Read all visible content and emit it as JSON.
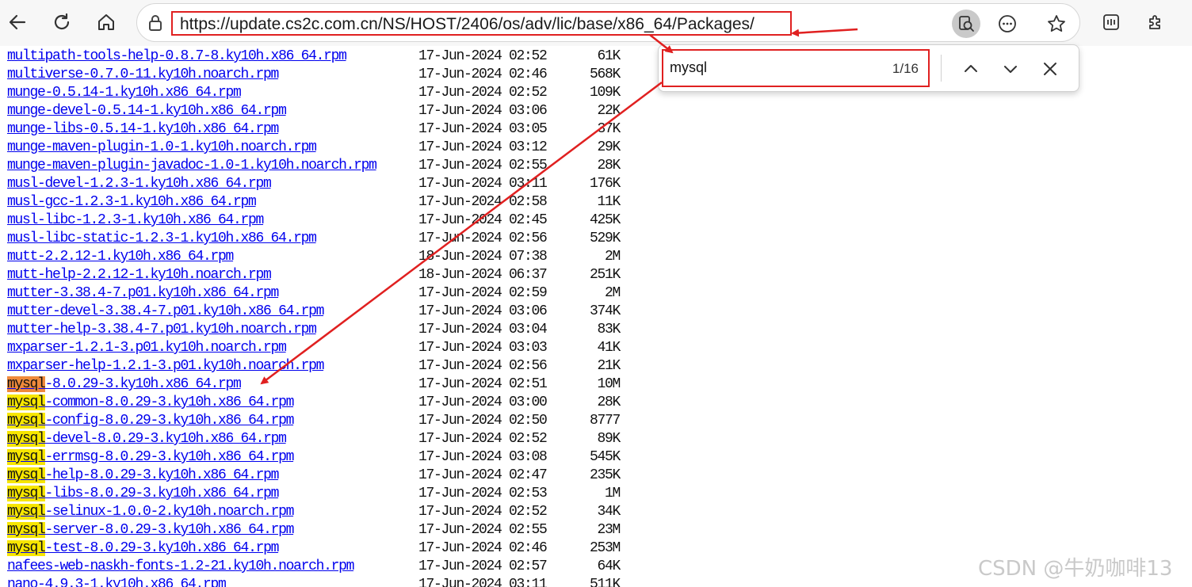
{
  "browser": {
    "url": "https://update.cs2c.com.cn/NS/HOST/2406/os/adv/lic/base/x86_64/Packages/"
  },
  "find": {
    "query": "mysql",
    "count": "1/16"
  },
  "listing": {
    "highlight_term": "mysql",
    "rows": [
      {
        "name": "multipath-tools-help-0.8.7-8.ky10h.x86_64.rpm",
        "date": "17-Jun-2024 02:52",
        "size": "61K"
      },
      {
        "name": "multiverse-0.7.0-11.ky10h.noarch.rpm",
        "date": "17-Jun-2024 02:46",
        "size": "568K"
      },
      {
        "name": "munge-0.5.14-1.ky10h.x86_64.rpm",
        "date": "17-Jun-2024 02:52",
        "size": "109K"
      },
      {
        "name": "munge-devel-0.5.14-1.ky10h.x86_64.rpm",
        "date": "17-Jun-2024 03:06",
        "size": "22K"
      },
      {
        "name": "munge-libs-0.5.14-1.ky10h.x86_64.rpm",
        "date": "17-Jun-2024 03:05",
        "size": "37K"
      },
      {
        "name": "munge-maven-plugin-1.0-1.ky10h.noarch.rpm",
        "date": "17-Jun-2024 03:12",
        "size": "29K"
      },
      {
        "name": "munge-maven-plugin-javadoc-1.0-1.ky10h.noarch.rpm",
        "date": "17-Jun-2024 02:55",
        "size": "28K"
      },
      {
        "name": "musl-devel-1.2.3-1.ky10h.x86_64.rpm",
        "date": "17-Jun-2024 03:11",
        "size": "176K"
      },
      {
        "name": "musl-gcc-1.2.3-1.ky10h.x86_64.rpm",
        "date": "17-Jun-2024 02:58",
        "size": "11K"
      },
      {
        "name": "musl-libc-1.2.3-1.ky10h.x86_64.rpm",
        "date": "17-Jun-2024 02:45",
        "size": "425K"
      },
      {
        "name": "musl-libc-static-1.2.3-1.ky10h.x86_64.rpm",
        "date": "17-Jun-2024 02:56",
        "size": "529K"
      },
      {
        "name": "mutt-2.2.12-1.ky10h.x86_64.rpm",
        "date": "18-Jun-2024 07:38",
        "size": "2M"
      },
      {
        "name": "mutt-help-2.2.12-1.ky10h.noarch.rpm",
        "date": "18-Jun-2024 06:37",
        "size": "251K"
      },
      {
        "name": "mutter-3.38.4-7.p01.ky10h.x86_64.rpm",
        "date": "17-Jun-2024 02:59",
        "size": "2M"
      },
      {
        "name": "mutter-devel-3.38.4-7.p01.ky10h.x86_64.rpm",
        "date": "17-Jun-2024 03:06",
        "size": "374K"
      },
      {
        "name": "mutter-help-3.38.4-7.p01.ky10h.noarch.rpm",
        "date": "17-Jun-2024 03:04",
        "size": "83K"
      },
      {
        "name": "mxparser-1.2.1-3.p01.ky10h.noarch.rpm",
        "date": "17-Jun-2024 03:03",
        "size": "41K"
      },
      {
        "name": "mxparser-help-1.2.1-3.p01.ky10h.noarch.rpm",
        "date": "17-Jun-2024 02:56",
        "size": "21K"
      },
      {
        "name": "mysql-8.0.29-3.ky10h.x86_64.rpm",
        "date": "17-Jun-2024 02:51",
        "size": "10M"
      },
      {
        "name": "mysql-common-8.0.29-3.ky10h.x86_64.rpm",
        "date": "17-Jun-2024 03:00",
        "size": "28K"
      },
      {
        "name": "mysql-config-8.0.29-3.ky10h.x86_64.rpm",
        "date": "17-Jun-2024 02:50",
        "size": "8777"
      },
      {
        "name": "mysql-devel-8.0.29-3.ky10h.x86_64.rpm",
        "date": "17-Jun-2024 02:52",
        "size": "89K"
      },
      {
        "name": "mysql-errmsg-8.0.29-3.ky10h.x86_64.rpm",
        "date": "17-Jun-2024 03:08",
        "size": "545K"
      },
      {
        "name": "mysql-help-8.0.29-3.ky10h.x86_64.rpm",
        "date": "17-Jun-2024 02:47",
        "size": "235K"
      },
      {
        "name": "mysql-libs-8.0.29-3.ky10h.x86_64.rpm",
        "date": "17-Jun-2024 02:53",
        "size": "1M"
      },
      {
        "name": "mysql-selinux-1.0.0-2.ky10h.noarch.rpm",
        "date": "17-Jun-2024 02:52",
        "size": "34K"
      },
      {
        "name": "mysql-server-8.0.29-3.ky10h.x86_64.rpm",
        "date": "17-Jun-2024 02:55",
        "size": "23M"
      },
      {
        "name": "mysql-test-8.0.29-3.ky10h.x86_64.rpm",
        "date": "17-Jun-2024 02:46",
        "size": "253M"
      },
      {
        "name": "nafees-web-naskh-fonts-1.2-21.ky10h.noarch.rpm",
        "date": "17-Jun-2024 02:57",
        "size": "64K"
      },
      {
        "name": "nano-4.9.3-1.ky10h.x86_64.rpm",
        "date": "17-Jun-2024 03:11",
        "size": "511K"
      }
    ]
  },
  "watermark": "CSDN @牛奶咖啡13",
  "colors": {
    "annotation_red": "#e02020",
    "match_highlight": "#f7e600",
    "active_match": "#ef8a3c",
    "link": "#0000ee"
  }
}
